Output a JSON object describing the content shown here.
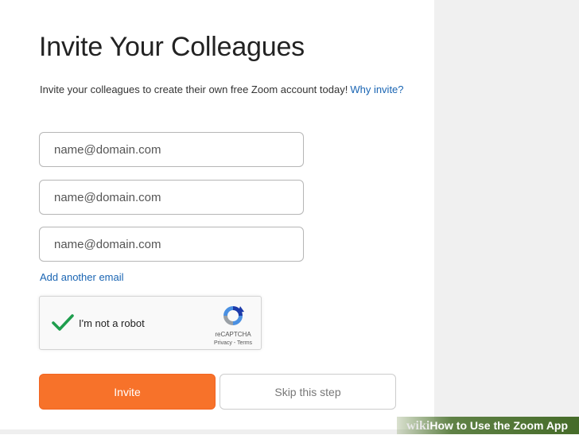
{
  "page": {
    "title": "Invite Your Colleagues",
    "subtitle": "Invite your colleagues to create their own free Zoom account today!",
    "why_link": "Why invite?"
  },
  "form": {
    "emails": [
      {
        "placeholder": "name@domain.com",
        "value": ""
      },
      {
        "placeholder": "name@domain.com",
        "value": ""
      },
      {
        "placeholder": "name@domain.com",
        "value": ""
      }
    ],
    "add_link": "Add another email"
  },
  "recaptcha": {
    "label": "I'm not a robot",
    "checked": true,
    "brand": "reCAPTCHA",
    "privacy": "Privacy",
    "separator": " - ",
    "terms": "Terms",
    "check_color": "#1f9e4e"
  },
  "actions": {
    "invite_label": "Invite",
    "skip_label": "Skip this step"
  },
  "colors": {
    "accent": "#f7722a",
    "link": "#1a65b3",
    "side_panel": "#f0f0f0"
  },
  "watermark": {
    "prefix": "wiki",
    "text": "How to Use the Zoom App"
  }
}
